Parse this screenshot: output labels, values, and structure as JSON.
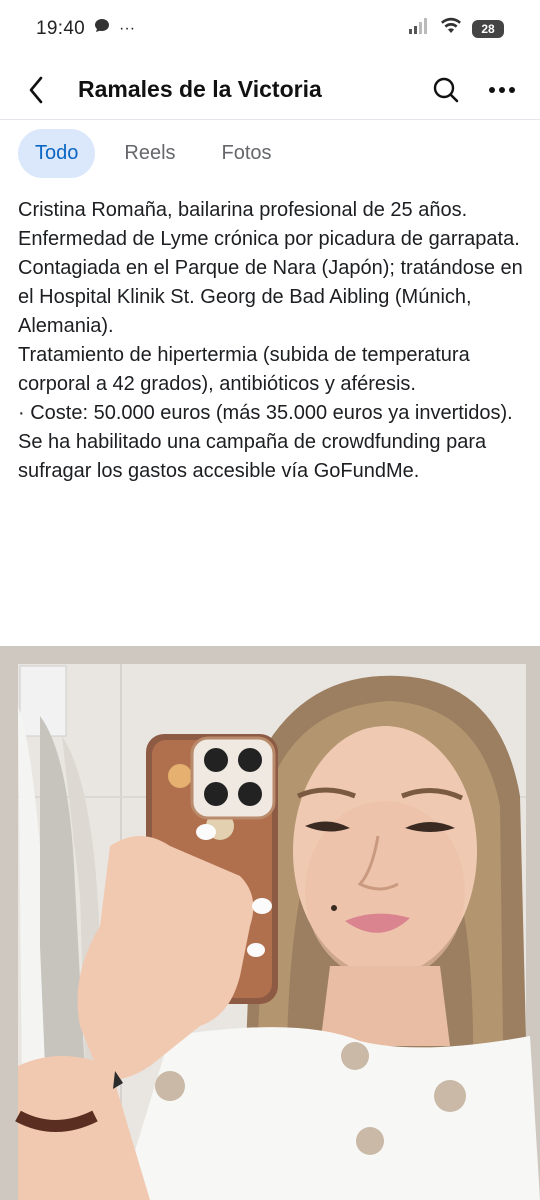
{
  "status_bar": {
    "time": "19:40",
    "more_indicator": "···",
    "battery_level": "28"
  },
  "header": {
    "title": "Ramales de la Victoria"
  },
  "tabs": [
    {
      "label": "Todo",
      "active": true
    },
    {
      "label": "Reels",
      "active": false
    },
    {
      "label": "Fotos",
      "active": false
    }
  ],
  "post": {
    "lines": [
      "Cristina Romaña, bailarina profesional de 25 años.",
      "Enfermedad de Lyme crónica por picadura de garrapata.",
      "Contagiada en el Parque de Nara (Japón); tratándose en el Hospital Klinik St. Georg de Bad Aibling (Múnich, Alemania).",
      "Tratamiento de hipertermia (subida de temperatura corporal a 42 grados), antibióticos y aféresis.",
      "· Coste: 50.000 euros (más 35.000 euros ya invertidos).",
      "Se ha habilitado una campaña de crowdfunding para sufragar los gastos accesible vía GoFundMe."
    ]
  },
  "colors": {
    "accent": "#0a66c2",
    "tab_active_bg": "#dbe7fb",
    "muted": "#65676b"
  }
}
